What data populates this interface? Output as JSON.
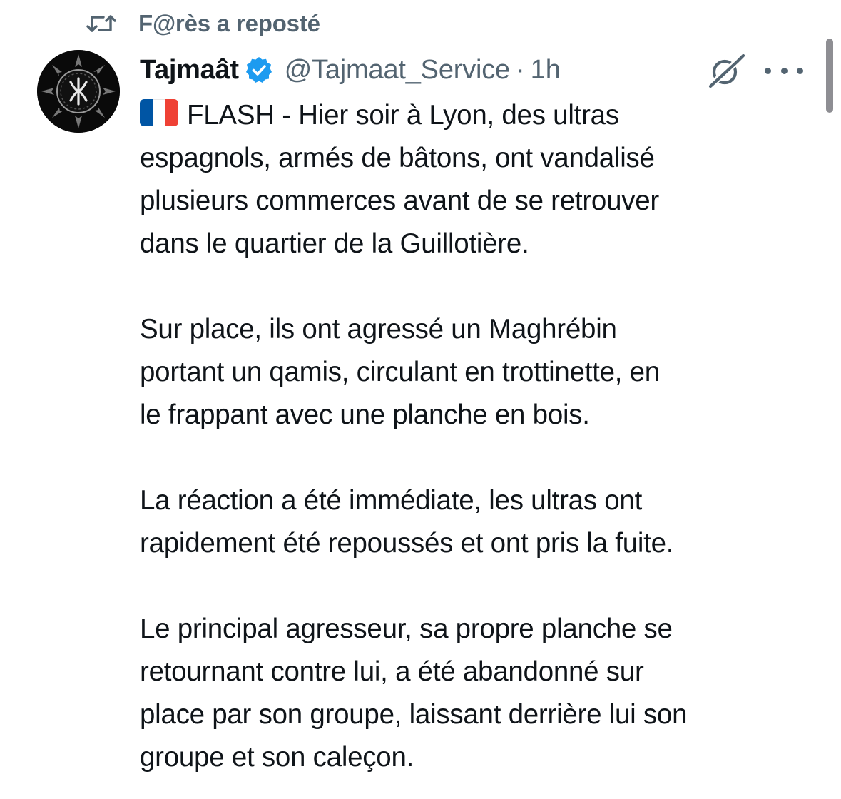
{
  "repost": {
    "icon": "repost-icon",
    "text": "F@rès a reposté"
  },
  "tweet": {
    "avatar_icon": "tifinagh-yaz-icon",
    "display_name": "Tajmaât",
    "verified_icon": "verified-badge-icon",
    "verified_color": "#1d9bf0",
    "handle": "@Tajmaat_Service",
    "separator": "·",
    "time": "1h",
    "grok_icon": "grok-icon",
    "more_icon": "more-icon",
    "flag": "french-flag",
    "paragraphs": [
      {
        "lines": [
          "FLASH - Hier soir à Lyon, des ultras",
          "espagnols, armés de bâtons, ont vandalisé",
          "plusieurs commerces avant de se retrouver",
          "dans le quartier de la Guillotière."
        ]
      },
      {
        "lines": [
          "Sur place, ils ont agressé un Maghrébin",
          "portant un qamis, circulant en trottinette, en",
          "le frappant avec une planche en bois."
        ]
      },
      {
        "lines": [
          "La réaction a été immédiate, les ultras ont",
          "rapidement été repoussés et ont pris la fuite."
        ]
      },
      {
        "lines": [
          "Le principal agresseur, sa propre planche se",
          "retournant contre lui, a été abandonné sur",
          "place par son groupe, laissant derrière lui son",
          "groupe et son caleçon."
        ]
      }
    ]
  },
  "colors": {
    "text": "#0f1419",
    "secondary": "#536471",
    "accent": "#1d9bf0",
    "flag_blue": "#0055a4",
    "flag_white": "#ffffff",
    "flag_red": "#ef4135"
  }
}
